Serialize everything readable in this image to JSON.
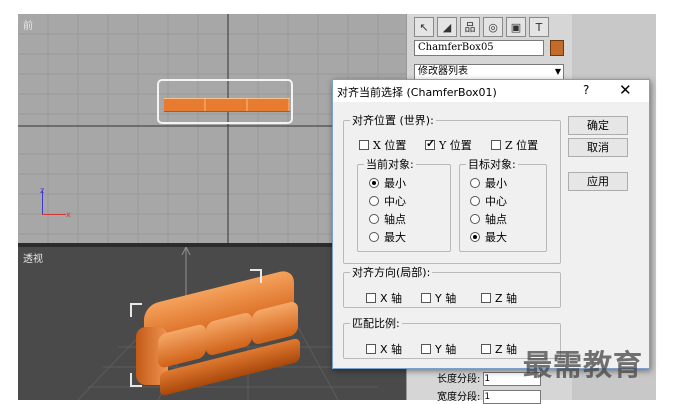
{
  "viewports": {
    "front_label": "前",
    "perspective_label": "透视"
  },
  "command_panel": {
    "object_name": "ChamferBox05",
    "object_color": "#c46a2a",
    "modifier_list": "修改器列表",
    "toolbar_icons": [
      "create-icon",
      "modify-icon",
      "hierarchy-icon",
      "motion-icon",
      "display-icon",
      "utilities-icon"
    ],
    "params": [
      {
        "label": "长度分段:",
        "value": "1"
      },
      {
        "label": "宽度分段:",
        "value": "1"
      }
    ]
  },
  "dialog": {
    "title": "对齐当前选择 (ChamferBox01)",
    "help": "?",
    "close": "✕",
    "align_position": {
      "legend": "对齐位置 (世界):",
      "x_label": "X 位置",
      "y_label": "Y 位置",
      "z_label": "Z 位置",
      "x_checked": false,
      "y_checked": true,
      "z_checked": false
    },
    "current_object": {
      "legend": "当前对象:",
      "options": [
        "最小",
        "中心",
        "轴点",
        "最大"
      ],
      "selected": 0
    },
    "target_object": {
      "legend": "目标对象:",
      "options": [
        "最小",
        "中心",
        "轴点",
        "最大"
      ],
      "selected": 3
    },
    "align_orientation": {
      "legend": "对齐方向(局部):",
      "x_label": "X 轴",
      "y_label": "Y 轴",
      "z_label": "Z 轴"
    },
    "match_scale": {
      "legend": "匹配比例:",
      "x_label": "X 轴",
      "y_label": "Y 轴",
      "z_label": "Z 轴"
    },
    "buttons": {
      "ok": "确定",
      "cancel": "取消",
      "apply": "应用"
    }
  },
  "watermark": "最需教育"
}
